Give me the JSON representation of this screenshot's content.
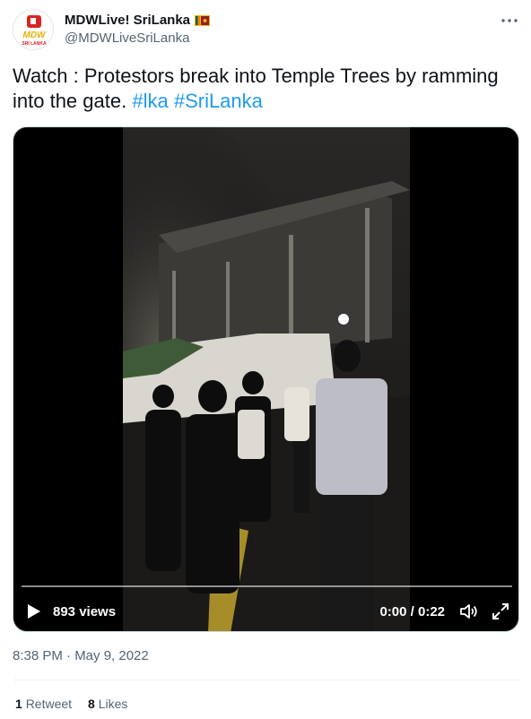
{
  "header": {
    "display_name": "MDWLive! SriLanka",
    "handle": "@MDWLiveSriLanka",
    "avatar_text": "MDW",
    "avatar_subtext": "SRI LANKA"
  },
  "tweet": {
    "text": "Watch : Protestors break into Temple Trees by ramming into the gate.",
    "hashtags": [
      "#lka",
      "#SriLanka"
    ]
  },
  "video": {
    "views": "893 views",
    "time": "0:00 / 0:22",
    "progress": 0
  },
  "meta": {
    "timestamp": "8:38 PM · May 9, 2022"
  },
  "stats": {
    "retweets_count": "1",
    "retweets_label": "Retweet",
    "likes_count": "8",
    "likes_label": "Likes"
  },
  "colors": {
    "link": "#1d9bf0",
    "secondary_text": "#536471",
    "brand_red": "#d92323"
  }
}
